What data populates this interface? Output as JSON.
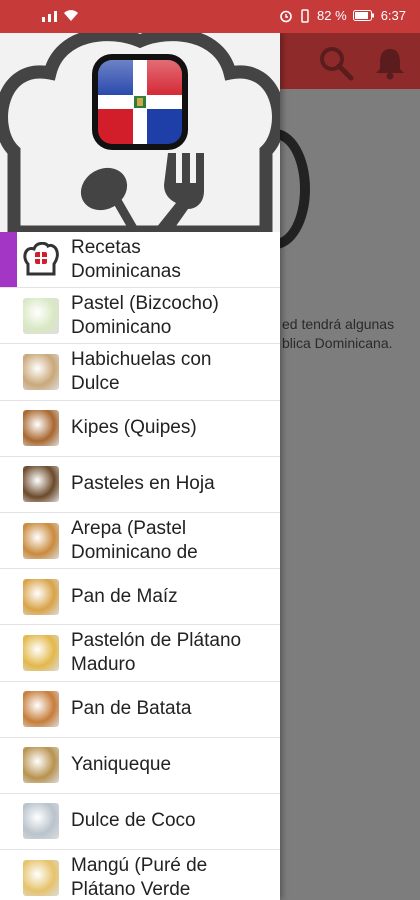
{
  "status_bar": {
    "battery_percent": "82 %",
    "time": "6:37"
  },
  "background": {
    "text_line1": "ed tendrá algunas",
    "text_line2": "blica Dominicana."
  },
  "drawer": {
    "items": [
      {
        "line1": "Recetas",
        "line2": "Dominicanas",
        "thumb_color": "#ffffff",
        "icon": "chef-hat-flag-icon"
      },
      {
        "line1": "Pastel (Bizcocho)",
        "line2": "Dominicano",
        "thumb_color": "#d9e8c4",
        "icon": "cake-thumb"
      },
      {
        "line1": "Habichuelas con",
        "line2": "Dulce",
        "thumb_color": "#c9a87a",
        "icon": "habichuelas-thumb"
      },
      {
        "line1": "Kipes (Quipes)",
        "line2": "",
        "thumb_color": "#a8672f",
        "icon": "kipes-thumb"
      },
      {
        "line1": "Pasteles en Hoja",
        "line2": "",
        "thumb_color": "#6b4a2a",
        "icon": "pasteles-thumb"
      },
      {
        "line1": "Arepa (Pastel",
        "line2": "Dominicano de",
        "thumb_color": "#c98a3d",
        "icon": "arepa-thumb"
      },
      {
        "line1": "Pan de Maíz",
        "line2": "",
        "thumb_color": "#d9a347",
        "icon": "pan-maiz-thumb"
      },
      {
        "line1": "Pastelón de Plátano",
        "line2": "Maduro",
        "thumb_color": "#e3b84a",
        "icon": "pastelon-thumb"
      },
      {
        "line1": "Pan de Batata",
        "line2": "",
        "thumb_color": "#c77d3a",
        "icon": "pan-batata-thumb"
      },
      {
        "line1": "Yaniqueque",
        "line2": "",
        "thumb_color": "#b8924f",
        "icon": "yaniqueque-thumb"
      },
      {
        "line1": "Dulce de Coco",
        "line2": "",
        "thumb_color": "#b9c3cc",
        "icon": "coco-thumb"
      },
      {
        "line1": "Mangú (Puré de",
        "line2": "Plátano Verde",
        "thumb_color": "#e6c36b",
        "icon": "mangu-thumb"
      }
    ]
  },
  "colors": {
    "status_bar": "#c63a3a",
    "toolbar": "#8f2a2a",
    "active_indicator": "#a336c4"
  }
}
